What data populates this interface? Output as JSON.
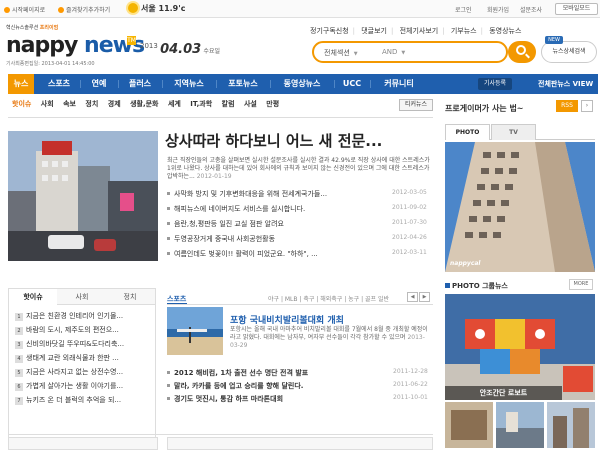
{
  "topbar": {
    "left1": "시작페이지로",
    "left2": "즐겨찾기추가하기",
    "weather": "서울 11.9'c",
    "right": [
      "로그인",
      "회원가입",
      "설문조사"
    ],
    "print": "모바일모드"
  },
  "logo": {
    "tagline_pre": "혁신뉴스솔루션 ",
    "tagline_brand": "프리이엄",
    "word_a": "nappy",
    "word_b": "news",
    "mark": "TM",
    "updated": "기사최종편집일: 2013-04-01 14:45:00"
  },
  "date": {
    "year": "2013",
    "md": "04.03",
    "weekday": "수요일"
  },
  "toplinks": [
    "정기구독신청",
    "댓글보기",
    "전체기사보기",
    "기부뉴스",
    "동영상뉴스"
  ],
  "search": {
    "field1": "전체섹션",
    "field2": "AND",
    "placeholder": "",
    "detail": "뉴스상세검색",
    "new_badge": "NEW"
  },
  "nav": {
    "items": [
      "뉴스",
      "스포츠",
      "연예",
      "플러스",
      "지역뉴스",
      "포토뉴스",
      "동영상뉴스",
      "UCC",
      "커뮤니티"
    ],
    "press": "기사등록",
    "edition": "전체판뉴스 VIEW"
  },
  "subnav": [
    "핫이슈",
    "사회",
    "속보",
    "정치",
    "경제",
    "생활,문화",
    "세계",
    "IT,과학",
    "칼럼",
    "사설",
    "만평"
  ],
  "todaynews": "티커뉴스",
  "pro_section": "프로게이머가 사는 법~",
  "rss": "RSS",
  "headline": "상사따라 하다보니 어느 새 전문...",
  "summary": {
    "text": "최근 직장인들의 고충을 살펴보면 실시한 설문조사를 실시한 결과 42.9%로 직장 상사에 대한 스트레스가 1위로 나왔다. 상사를 대하는데 있어 회사에의 규칙과 보이지 않는 신경전이 있으며 그에 대한 스트레스가 압박하는",
    "date": "2012-01-19"
  },
  "headlines": [
    {
      "title": "사막화 방지 및 기후변화대응을 위해 전세계국가들...",
      "date": "2012-03-05"
    },
    {
      "title": "해피뉴스에 네이버지도 서비스를 실시합니다.",
      "date": "2011-09-02"
    },
    {
      "title": "음란,청,평판등 일진 교실 점판 알려요",
      "date": "2011-07-30"
    },
    {
      "title": "두영공장거게 중국내 사회공헌활동",
      "date": "2012-04-26"
    },
    {
      "title": "여름인데도 벚꽃이!! 활력이 피었군요. \"하하\", ...",
      "date": "2012-03-11"
    }
  ],
  "tabbox": {
    "tabs": [
      "핫이슈",
      "사회",
      "정치"
    ],
    "items": [
      "지금은 친환경 인테리어 인기몰...",
      "바람의 도시, 제주도의 편전으...",
      "신비의바닷길 뚜우띠&도다리축...",
      "생태계 교란 외래식물과 한판 ...",
      "지금은 사라지고 없는 상전수영...",
      "가볍게 살아가는 생활 이야기를...",
      "뉴키즈 온 더 블럭의 추억을 되..."
    ]
  },
  "sports": {
    "header": "스포츠",
    "tags": "야구 | MLB | 축구 | 해외축구 | 농구 | 골프 일반",
    "headline": "포항 국내비치발리볼대회 개최",
    "summary": "포항시는 올해 국내 아마추어 비치발리볼 대회를 7월에서 8월 중 개최할 예정이라고 밝혔다. 대회에는 남자부, 여자부 선수들이 각각 참가할 수 있으며",
    "date": "2013-03-29",
    "items": [
      {
        "title": "2012 해비컴, 1차 출전 선수 명단 전격 발표",
        "date": "2011-12-28"
      },
      {
        "title": "말라, 카카를 등에 업고 승리를 향해 달린다.",
        "date": "2011-06-22"
      },
      {
        "title": "경기도 멋진시, 통감 하프 마라톤대회",
        "date": "2011-10-01"
      }
    ]
  },
  "right": {
    "tabs": [
      "PHOTO",
      "TV"
    ],
    "photo_logo": "nappycal",
    "group_title": "PHOTO 그룹뉴스",
    "more": "MORE",
    "group_caption": "안조간단 로보트"
  },
  "colors": {
    "nav_blue": "#1f5fae",
    "accent_orange": "#f39800"
  }
}
